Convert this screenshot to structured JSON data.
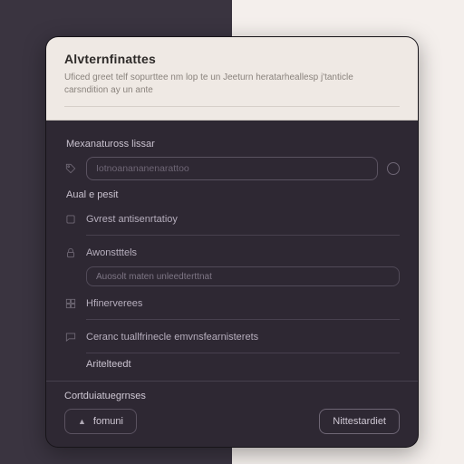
{
  "header": {
    "title": "Alvternfinattes",
    "subtitle": "Uficed greet telf sopurttee nm lop te un Jeeturn heratarheallesp j'tanticle carsndition ay un ante"
  },
  "body": {
    "section1_label": "Mexanatuross lissar",
    "input1_placeholder": "Iotnoanananenarattoo",
    "section2_label": "Aual e pesit",
    "rows": [
      {
        "icon": "square",
        "label": "Gvrest antisenrtatioy"
      },
      {
        "icon": "lock",
        "label": "Awonstttels"
      },
      {
        "icon": "grid",
        "label": "Hfinerverees"
      },
      {
        "icon": "chat",
        "label": "Ceranc tuallfrinecle emvnsfearnisterets"
      }
    ],
    "sub_pill": "Auosolt maten unleedterttnat",
    "small_label": "Aritelteedt"
  },
  "footer": {
    "label": "Cortduiatuegrnses",
    "secondary_btn": "fomuni",
    "primary_btn": "Nittestardiet"
  }
}
